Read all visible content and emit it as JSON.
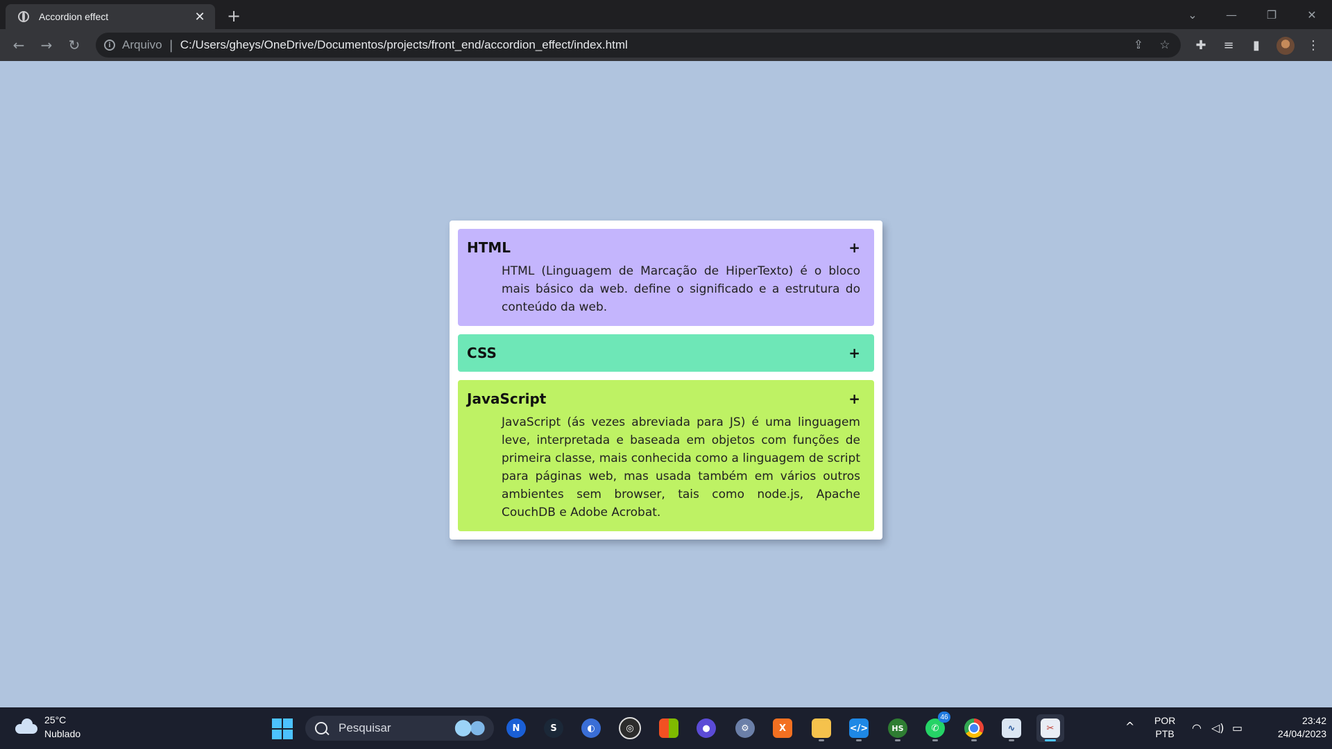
{
  "browser": {
    "tab_title": "Accordion effect",
    "tab_close": "✕",
    "new_tab": "+",
    "address_scheme": "Arquivo",
    "address_url": "C:/Users/gheys/OneDrive/Documentos/projects/front_end/accordion_effect/index.html"
  },
  "accordion": {
    "items": [
      {
        "title": "HTML",
        "toggle": "+",
        "body": "HTML (Linguagem de Marcação de HiperTexto) é o bloco mais básico da web. define o significado e a estrutura do conteúdo da web.",
        "color": "#c4b5fd"
      },
      {
        "title": "CSS",
        "toggle": "+",
        "body": "",
        "color": "#6ee7b7"
      },
      {
        "title": "JavaScript",
        "toggle": "+",
        "body": "JavaScript (ás vezes abreviada para JS) é uma linguagem leve, interpretada e baseada em objetos com funções de primeira classe, mais conhecida como a linguagem de script para páginas web, mas usada também em vários outros ambientes sem browser, tais como node.js, Apache CouchDB e Adobe Acrobat.",
        "color": "#bef264"
      }
    ]
  },
  "taskbar": {
    "weather_temp": "25°C",
    "weather_desc": "Nublado",
    "search_placeholder": "Pesquisar",
    "whatsapp_badge": "46",
    "lang_top": "POR",
    "lang_bottom": "PTB",
    "time": "23:42",
    "date": "24/04/2023"
  }
}
